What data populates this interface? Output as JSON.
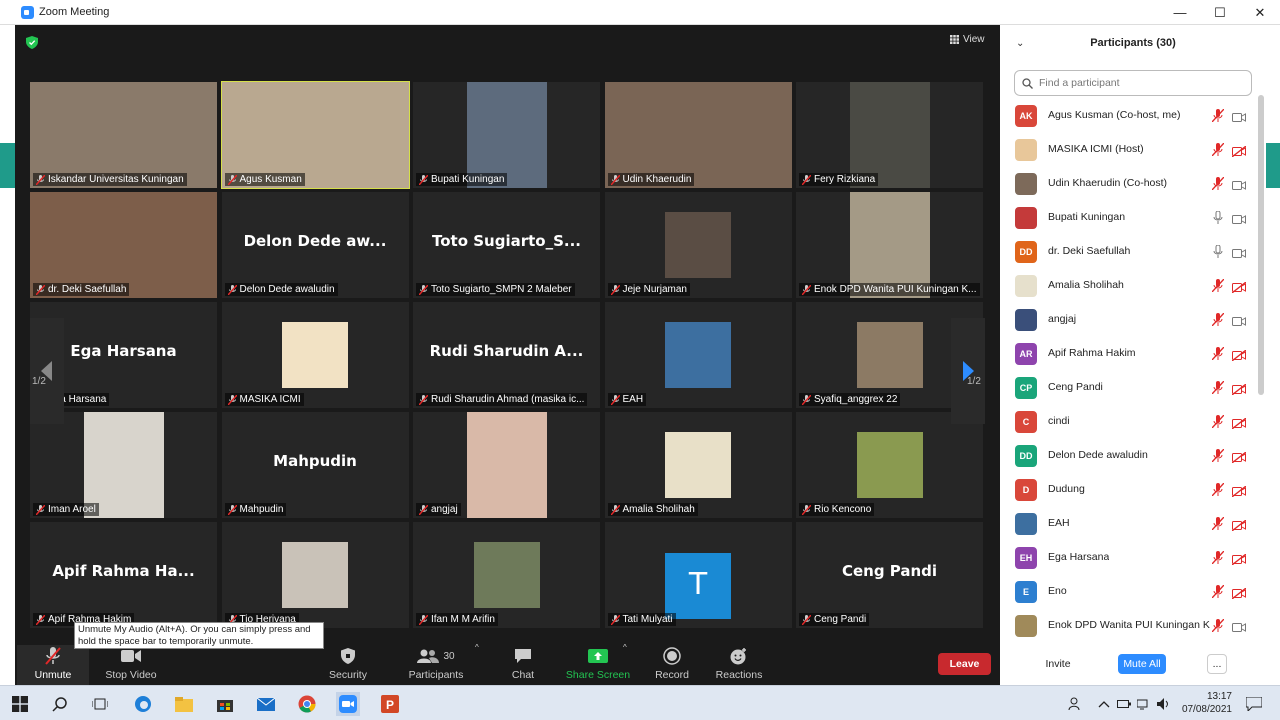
{
  "window": {
    "title": "Zoom Meeting",
    "minimize": "—",
    "maximize": "☐",
    "close": "✕"
  },
  "meeting": {
    "view_label": "View",
    "page_left": "1/2",
    "page_right": "1/2"
  },
  "tiles": [
    {
      "name": "Iskandar Universitas Kuningan",
      "big": "",
      "color": "#8a7a6a"
    },
    {
      "name": "Agus Kusman",
      "big": "",
      "color": "#b9a890"
    },
    {
      "name": "Bupati Kuningan",
      "big": "",
      "color": "#5d6b7d"
    },
    {
      "name": "Udin Khaerudin",
      "big": "",
      "color": "#7a6555"
    },
    {
      "name": "Fery Rizkiana",
      "big": "",
      "color": "#4a4a44"
    },
    {
      "name": "dr. Deki Saefullah",
      "big": "",
      "color": "#7d5e4a"
    },
    {
      "name": "Delon Dede awaludin",
      "big": "Delon Dede aw...",
      "color": ""
    },
    {
      "name": "Toto Sugiarto_SMPN 2 Maleber",
      "big": "Toto Sugiarto_S...",
      "color": ""
    },
    {
      "name": "Jeje Nurjaman",
      "big": "",
      "color": "#5a4d44"
    },
    {
      "name": "Enok DPD Wanita PUI Kuningan K...",
      "big": "",
      "color": "#a49a86"
    },
    {
      "name": "Ega Harsana",
      "big": "Ega Harsana",
      "color": ""
    },
    {
      "name": "MASIKA ICMI",
      "big": "",
      "color": "#f2e2c4"
    },
    {
      "name": "Rudi Sharudin Ahmad (masika ic...",
      "big": "Rudi Sharudin A...",
      "color": ""
    },
    {
      "name": "EAH",
      "big": "",
      "color": "#3d6fa0"
    },
    {
      "name": "Syafiq_anggrex 22",
      "big": "",
      "color": "#8c7a64"
    },
    {
      "name": "Iman Aroel",
      "big": "",
      "color": "#d8d4cc"
    },
    {
      "name": "Mahpudin",
      "big": "Mahpudin",
      "color": ""
    },
    {
      "name": "angjaj",
      "big": "",
      "color": "#d9b9a8"
    },
    {
      "name": "Amalia Sholihah",
      "big": "",
      "color": "#e8e0c8"
    },
    {
      "name": "Rio Kencono",
      "big": "",
      "color": "#8a9a50"
    },
    {
      "name": "Apif Rahma Hakim",
      "big": "Apif Rahma Ha...",
      "color": ""
    },
    {
      "name": "Tio Herivana",
      "big": "",
      "color": "#c9c2b8"
    },
    {
      "name": "Ifan M M Arifin",
      "big": "",
      "color": "#6e7a5a"
    },
    {
      "name": "Tati Mulyati",
      "big": "T",
      "color": "#1a8ad4"
    },
    {
      "name": "Ceng Pandi",
      "big": "Ceng Pandi",
      "color": ""
    }
  ],
  "tooltip": "Unmute My Audio (Alt+A). Or you can simply press and hold the space bar to temporarily unmute.",
  "toolbar": {
    "unmute": "Unmute",
    "stop_video": "Stop Video",
    "security": "Security",
    "participants": "Participants",
    "participants_count": "30",
    "chat": "Chat",
    "share": "Share Screen",
    "record": "Record",
    "reactions": "Reactions",
    "leave": "Leave"
  },
  "panel": {
    "title": "Participants (30)",
    "search_placeholder": "Find a participant",
    "invite": "Invite",
    "mute_all": "Mute All",
    "more": "...",
    "participants": [
      {
        "initials": "AK",
        "name": "Agus Kusman (Co-host, me)",
        "color": "#d9473a",
        "mic": "muted",
        "video": "on"
      },
      {
        "initials": "",
        "name": "MASIKA ICMI (Host)",
        "color": "#e8c79a",
        "mic": "muted",
        "video": "off"
      },
      {
        "initials": "",
        "name": "Udin Khaerudin (Co-host)",
        "color": "#7d6a5a",
        "mic": "muted",
        "video": "on"
      },
      {
        "initials": "",
        "name": "Bupati Kuningan",
        "color": "#c43a3a",
        "mic": "on",
        "video": "on"
      },
      {
        "initials": "DD",
        "name": "dr. Deki Saefullah",
        "color": "#e0651a",
        "mic": "on",
        "video": "on"
      },
      {
        "initials": "",
        "name": "Amalia Sholihah",
        "color": "#e6e0cc",
        "mic": "muted",
        "video": "off"
      },
      {
        "initials": "",
        "name": "angjaj",
        "color": "#3a4f7a",
        "mic": "muted",
        "video": "on"
      },
      {
        "initials": "AR",
        "name": "Apif Rahma Hakim",
        "color": "#8e44ad",
        "mic": "muted",
        "video": "off"
      },
      {
        "initials": "CP",
        "name": "Ceng Pandi",
        "color": "#1aa57a",
        "mic": "muted",
        "video": "off"
      },
      {
        "initials": "C",
        "name": "cindi",
        "color": "#d9473a",
        "mic": "muted",
        "video": "off"
      },
      {
        "initials": "DD",
        "name": "Delon Dede awaludin",
        "color": "#1aa57a",
        "mic": "muted",
        "video": "off"
      },
      {
        "initials": "D",
        "name": "Dudung",
        "color": "#d9473a",
        "mic": "muted",
        "video": "off"
      },
      {
        "initials": "",
        "name": "EAH",
        "color": "#3d6fa0",
        "mic": "muted",
        "video": "off"
      },
      {
        "initials": "EH",
        "name": "Ega Harsana",
        "color": "#8e44ad",
        "mic": "muted",
        "video": "off"
      },
      {
        "initials": "E",
        "name": "Eno",
        "color": "#2d7fd0",
        "mic": "muted",
        "video": "off"
      },
      {
        "initials": "",
        "name": "Enok DPD Wanita PUI Kuningan K...",
        "color": "#a08a5a",
        "mic": "muted",
        "video": "on"
      }
    ]
  },
  "taskbar": {
    "time": "13:17",
    "date": "07/08/2021"
  }
}
